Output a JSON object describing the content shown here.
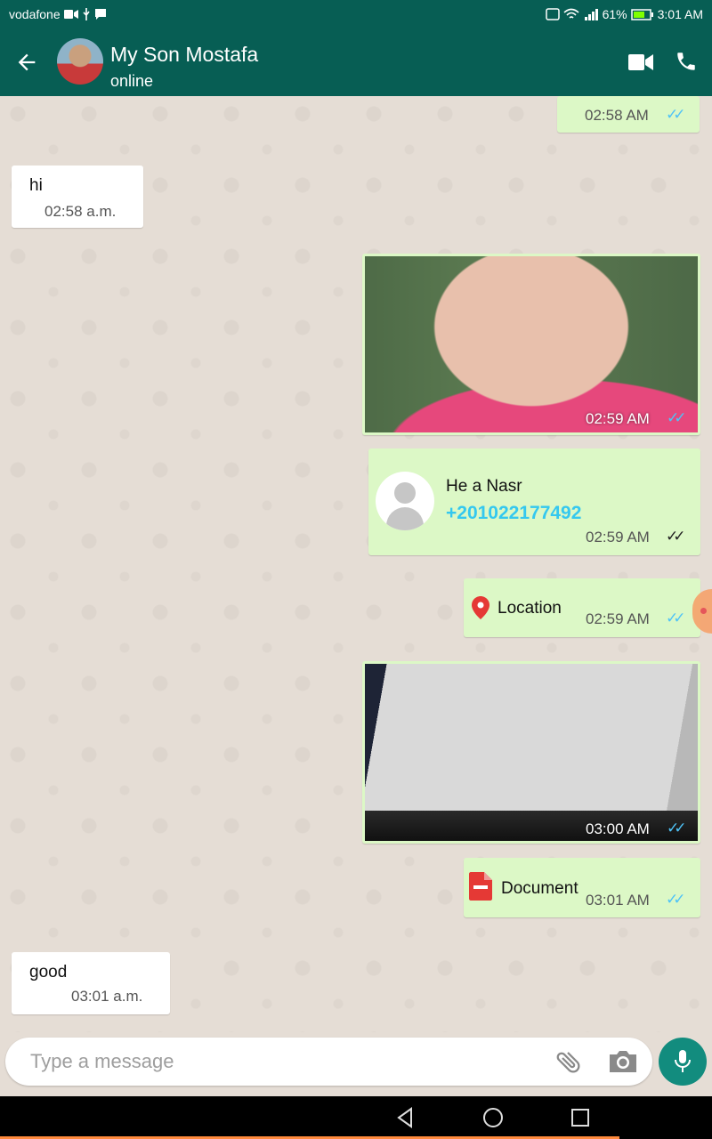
{
  "status_bar": {
    "carrier": "vodafone",
    "battery": "61%",
    "time": "3:01 AM"
  },
  "header": {
    "contact_name": "My Son Mostafa",
    "contact_status": "online"
  },
  "messages": [
    {
      "direction": "out",
      "type": "text",
      "time": "02:58 AM",
      "read": true
    },
    {
      "direction": "in",
      "type": "text",
      "text": "hi",
      "time": "02:58 a.m."
    },
    {
      "direction": "out",
      "type": "image",
      "time": "02:59 AM",
      "read": true
    },
    {
      "direction": "out",
      "type": "contact",
      "name": "He a Nasr",
      "phone": "+201022177492",
      "time": "02:59 AM",
      "read": false
    },
    {
      "direction": "out",
      "type": "location",
      "text": "Location",
      "time": "02:59 AM",
      "read": true
    },
    {
      "direction": "out",
      "type": "image",
      "time": "03:00 AM",
      "read": true
    },
    {
      "direction": "out",
      "type": "document",
      "text": "Document",
      "time": "03:01 AM",
      "read": true
    },
    {
      "direction": "in",
      "type": "text",
      "text": "good",
      "time": "03:01 a.m."
    }
  ],
  "composer": {
    "placeholder": "Type a message"
  },
  "colors": {
    "header": "#075e54",
    "outgoing_bubble": "#dcf8c6",
    "incoming_bubble": "#ffffff",
    "read_ticks": "#4fc3f7",
    "mic_button": "#128c7e",
    "phone_link": "#34c8ef"
  },
  "icons": {
    "back": "arrow-left-icon",
    "video": "video-camera-icon",
    "call": "phone-icon",
    "location": "map-pin-icon",
    "document": "pdf-file-icon",
    "attach": "paperclip-icon",
    "camera": "camera-icon",
    "mic": "microphone-icon"
  }
}
